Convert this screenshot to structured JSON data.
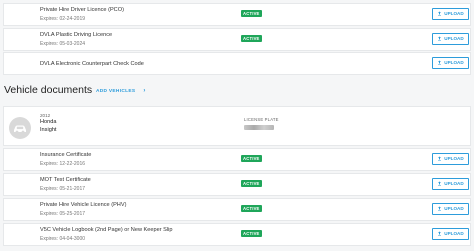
{
  "driver_documents": [
    {
      "name": "Private Hire Driver Licence (PCO)",
      "expires": "Expires: 02-24-2019",
      "status": "ACTIVE",
      "action": "UPLOAD"
    },
    {
      "name": "DVLA Plastic Driving Licence",
      "expires": "Expires: 05-03-2024",
      "status": "ACTIVE",
      "action": "UPLOAD"
    },
    {
      "name": "DVLA Electronic Counterpart Check Code",
      "action": "UPLOAD"
    }
  ],
  "vehicle_section": {
    "title": "Vehicle documents",
    "add_link": "ADD VEHICLES",
    "add_link_icon": "chevron-right-icon"
  },
  "vehicle": {
    "year": "2012",
    "make": "Honda",
    "model": "Insight",
    "plate_label": "LICENSE PLATE",
    "avatar_icon": "car-icon"
  },
  "vehicle_documents": [
    {
      "name": "Insurance Certificate",
      "expires": "Expires: 12-22-2016",
      "status": "ACTIVE",
      "action": "UPLOAD"
    },
    {
      "name": "MOT Test Certificate",
      "expires": "Expires: 05-21-2017",
      "status": "ACTIVE",
      "action": "UPLOAD"
    },
    {
      "name": "Private Hire Vehicle Licence (PHV)",
      "expires": "Expires: 05-25-2017",
      "status": "ACTIVE",
      "action": "UPLOAD"
    },
    {
      "name": "V5C Vehicle Logbook (2nd Page) or New Keeper Slip",
      "expires": "Expires: 04-04-3000",
      "status": "ACTIVE",
      "action": "UPLOAD"
    }
  ],
  "colors": {
    "active_badge": "#1fa65a",
    "upload_accent": "#2d9cdb",
    "link_accent": "#2d9cdb"
  }
}
